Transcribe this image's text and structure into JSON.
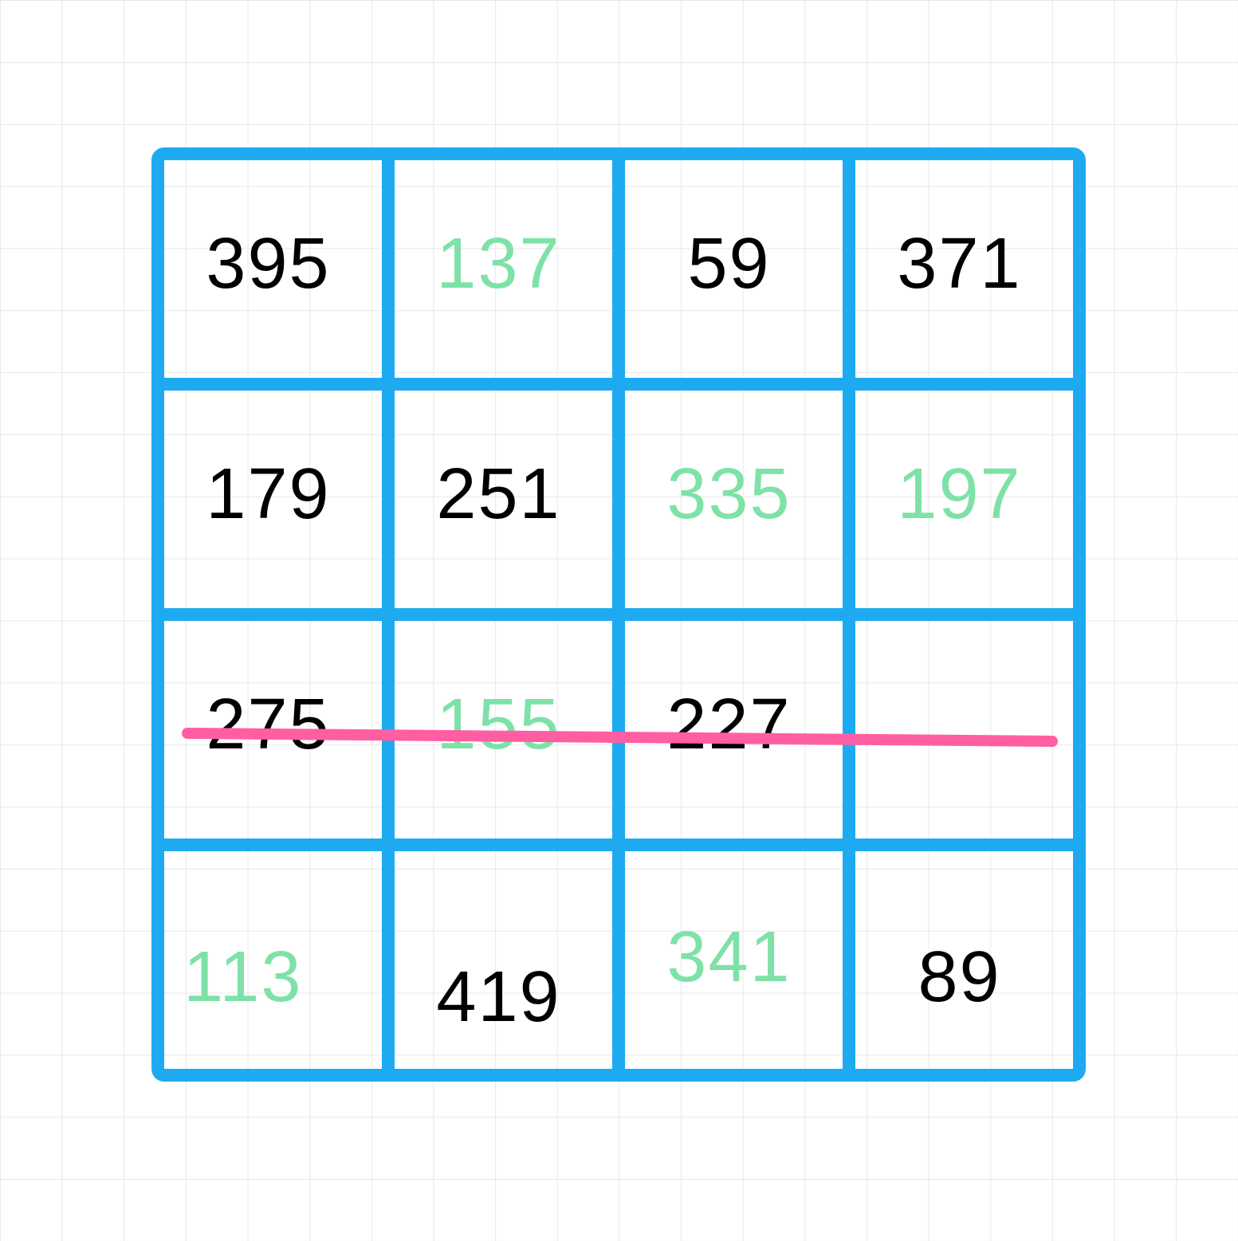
{
  "grid": {
    "rows": 4,
    "cols": 4,
    "borderColor": "#1eaaf1",
    "cells": [
      [
        {
          "value": "395",
          "color": "black"
        },
        {
          "value": "137",
          "color": "green"
        },
        {
          "value": "59",
          "color": "black"
        },
        {
          "value": "371",
          "color": "black"
        }
      ],
      [
        {
          "value": "179",
          "color": "black"
        },
        {
          "value": "251",
          "color": "black"
        },
        {
          "value": "335",
          "color": "green"
        },
        {
          "value": "197",
          "color": "green"
        }
      ],
      [
        {
          "value": "275",
          "color": "black"
        },
        {
          "value": "155",
          "color": "green"
        },
        {
          "value": "227",
          "color": "black"
        },
        {
          "value": "",
          "color": "black"
        }
      ],
      [
        {
          "value": "113",
          "color": "green"
        },
        {
          "value": "419",
          "color": "black"
        },
        {
          "value": "341",
          "color": "green"
        },
        {
          "value": "89",
          "color": "black"
        }
      ]
    ]
  },
  "strike": {
    "color": "#ff5fa2",
    "row": 2
  }
}
